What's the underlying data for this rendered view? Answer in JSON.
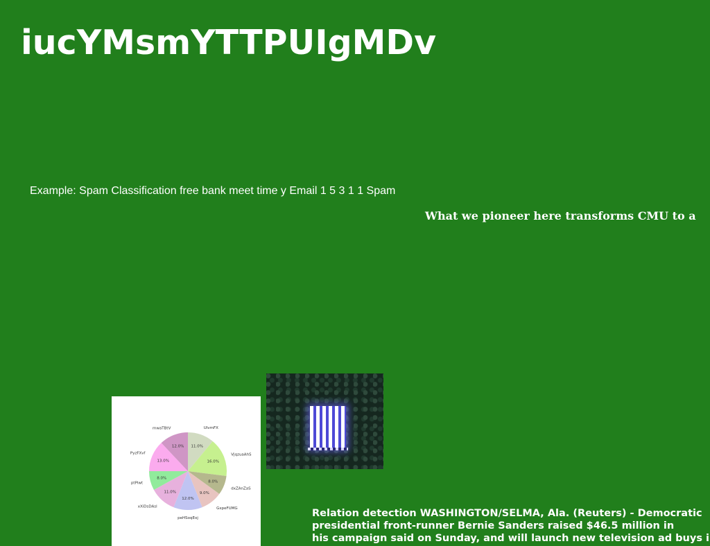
{
  "title": "iucYMsmYTTPUIgMDv",
  "example_text": "Example: Spam Classification free bank meet time y Email 1 5 3 1 1 Spam",
  "tagline": "What we pioneer here transforms CMU to a",
  "news_lines": [
    "Relation detection WASHINGTON/SELMA, Ala. (Reuters) - Democratic",
    "presidential front-runner Bernie Sanders raised $46.5 million in",
    "his campaign said on Sunday, and will launch new television ad buys in"
  ],
  "chart_data": {
    "type": "pie",
    "categories": [
      "UIvmFX",
      "VjqzuaAhS",
      "dxZAnZaS",
      "GxpeFUMG",
      "peHSoqEoj",
      "xXiDsDAsl",
      "ptPlwt",
      "PyzFXvf",
      "mwaTBtV"
    ],
    "values": [
      11.0,
      16.0,
      8.0,
      9.0,
      12.0,
      11.0,
      8.0,
      13.0,
      12.0
    ],
    "labels_pct": [
      "11.0%",
      "16.0%",
      "8.0%",
      "9.0%",
      "12.0%",
      "11.0%",
      "8.0%",
      "13.0%",
      "12.0%"
    ],
    "colors": [
      "#d1dbc1",
      "#c6f08f",
      "#b5b88d",
      "#e8c4c0",
      "#c0c4f2",
      "#e7b1dd",
      "#91eb9c",
      "#fbabee",
      "#cf96c5"
    ],
    "start_angle_deg": 90,
    "direction": "clockwise"
  }
}
